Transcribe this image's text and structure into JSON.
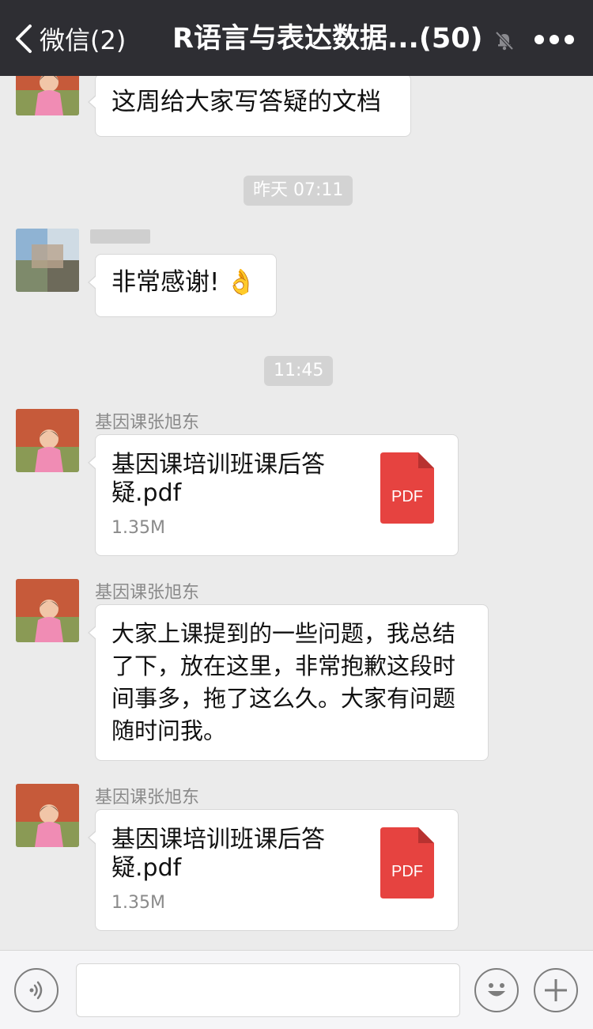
{
  "navbar": {
    "back_label": "微信(2)",
    "title": "R语言与表达数据...(50)"
  },
  "chat": {
    "msg1_text": "这周给大家写答疑的文档",
    "timestamp1": "昨天 07:11",
    "msg2_text": "非常感谢!",
    "msg2_emoji": "👌",
    "timestamp2": "11:45",
    "msg3_sender": "基因课张旭东",
    "msg3_file_name": "基因课培训班课后答疑.pdf",
    "msg3_file_size": "1.35M",
    "msg3_file_type": "PDF",
    "msg4_sender": "基因课张旭东",
    "msg4_text": "大家上课提到的一些问题，我总结了下，放在这里，非常抱歉这段时间事多，拖了这么久。大家有问题随时问我。",
    "msg5_sender": "基因课张旭东",
    "msg5_file_name": "基因课培训班课后答疑.pdf",
    "msg5_file_size": "1.35M",
    "msg5_file_type": "PDF"
  },
  "colors": {
    "navbar_bg": "#2e2e33",
    "chat_bg": "#ebebeb",
    "pdf_red": "#e64340"
  },
  "icons": [
    "back-chevron-icon",
    "mute-bell-icon",
    "more-dots-icon",
    "voice-icon",
    "emoji-icon",
    "plus-icon",
    "pdf-icon"
  ]
}
